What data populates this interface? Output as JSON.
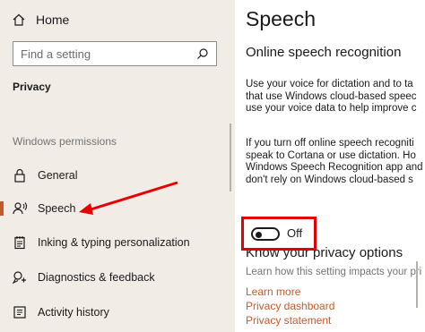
{
  "nav": {
    "home_label": "Home",
    "search_placeholder": "Find a setting",
    "section_title": "Privacy",
    "group_header": "Windows permissions",
    "items": [
      {
        "label": "General",
        "icon": "lock-icon"
      },
      {
        "label": "Speech",
        "icon": "speech-icon"
      },
      {
        "label": "Inking & typing personalization",
        "icon": "notepad-icon"
      },
      {
        "label": "Diagnostics & feedback",
        "icon": "feedback-icon"
      },
      {
        "label": "Activity history",
        "icon": "history-icon"
      }
    ]
  },
  "content": {
    "title": "Speech",
    "subtitle": "Online speech recognition",
    "para1": [
      "Use your voice for dictation and to ta",
      "that use Windows cloud-based speec",
      "use your voice data to help improve c"
    ],
    "para2": [
      "If you turn off online speech recogniti",
      "speak to Cortana or use dictation. Ho",
      "Windows Speech Recognition app and",
      "don't rely on Windows cloud-based s"
    ],
    "toggle_state": "Off",
    "privacy_title": "Know your privacy options",
    "privacy_desc": "Learn how this setting impacts your pri",
    "links": [
      "Learn more",
      "Privacy dashboard",
      "Privacy statement"
    ]
  },
  "colors": {
    "accent": "#c45a2a",
    "annotation": "#e60000",
    "nav_bg": "#f2ece7"
  }
}
